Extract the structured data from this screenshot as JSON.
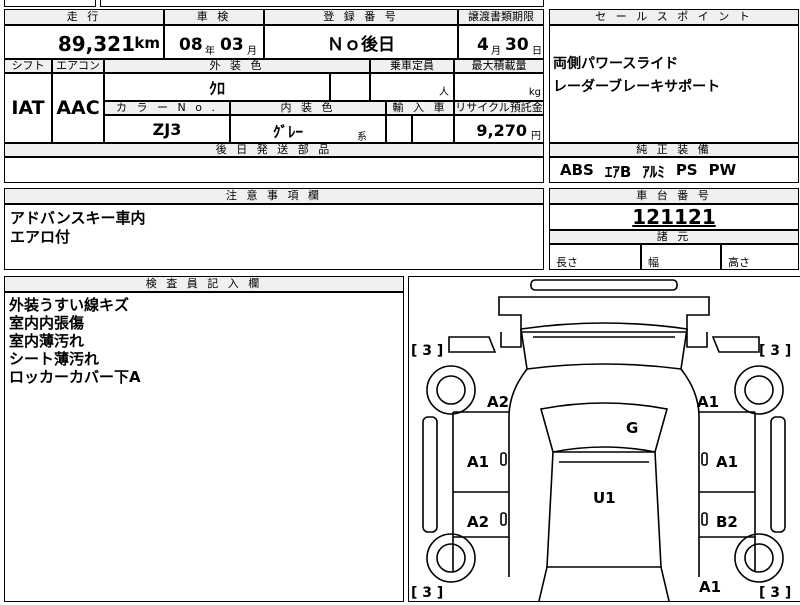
{
  "headers": {
    "mileage": "走 行",
    "inspection": "車 検",
    "registration": "登 録 番 号",
    "transfer_deadline": "譲渡書類期限",
    "sales_point": "セ ー ル ス ポ イ ン ト",
    "shift": "シフト",
    "aircon": "エアコン",
    "exterior_color": "外 装 色",
    "capacity": "乗車定員",
    "max_load": "最大積載量",
    "color_no": "カ ラ ー N o .",
    "interior_color": "内 装 色",
    "import": "輸 入 車",
    "recycle_fee": "リサイクル預託金",
    "later_parts": "後 日 発 送 部 品",
    "genuine_equipment": "純 正 装 備",
    "notes": "注 意 事 項 欄",
    "chassis_no": "車 台 番 号",
    "dimensions": "諸 元",
    "inspector_notes": "検 査 員 記 入 欄"
  },
  "vehicle": {
    "mileage_value": "89,321",
    "mileage_unit": "km",
    "inspection_year": "08",
    "inspection_year_unit": "年",
    "inspection_month": "03",
    "inspection_month_unit": "月",
    "registration_no": "Ｎｏ後日",
    "transfer_month": "4",
    "transfer_month_unit": "月",
    "transfer_day": "30",
    "transfer_day_unit": "日",
    "shift": "IAT",
    "aircon": "AAC",
    "exterior_color": "ｸﾛ",
    "capacity_unit": "人",
    "max_load_unit": "kg",
    "color_no": "ZJ3",
    "interior_color": "ｸﾞﾚｰ",
    "interior_color_suffix": "系",
    "recycle_fee_value": "9,270",
    "recycle_fee_unit": "円",
    "chassis_no": "121121"
  },
  "sales_points": [
    "両側パワースライド",
    "レーダーブレーキサポート"
  ],
  "equipment": [
    "ABS",
    "ｴｱB",
    "ｱﾙﾐ",
    "PS",
    "PW"
  ],
  "notes_lines": [
    "アドバンスキー車内",
    "エアロ付"
  ],
  "dimensions": {
    "length": "長さ",
    "width": "幅",
    "height": "高さ"
  },
  "inspector_lines": [
    "外装うすい線キズ",
    "室内内張傷",
    "室内薄汚れ",
    "シート薄汚れ",
    "ロッカーカバー下A"
  ],
  "diagram": {
    "tire_tl": "[ 3 ]",
    "tire_tr": "[ 3 ]",
    "tire_bl": "[ 3 ]",
    "tire_br": "[ 3 ]",
    "marks": {
      "fl_fender": "A2",
      "fr_fender": "A1",
      "windshield": "G",
      "fl_door": "A1",
      "fr_door": "A1",
      "roof": "U1",
      "rl_door": "A2",
      "rr_door": "B2",
      "rr_quarter": "A1"
    }
  }
}
